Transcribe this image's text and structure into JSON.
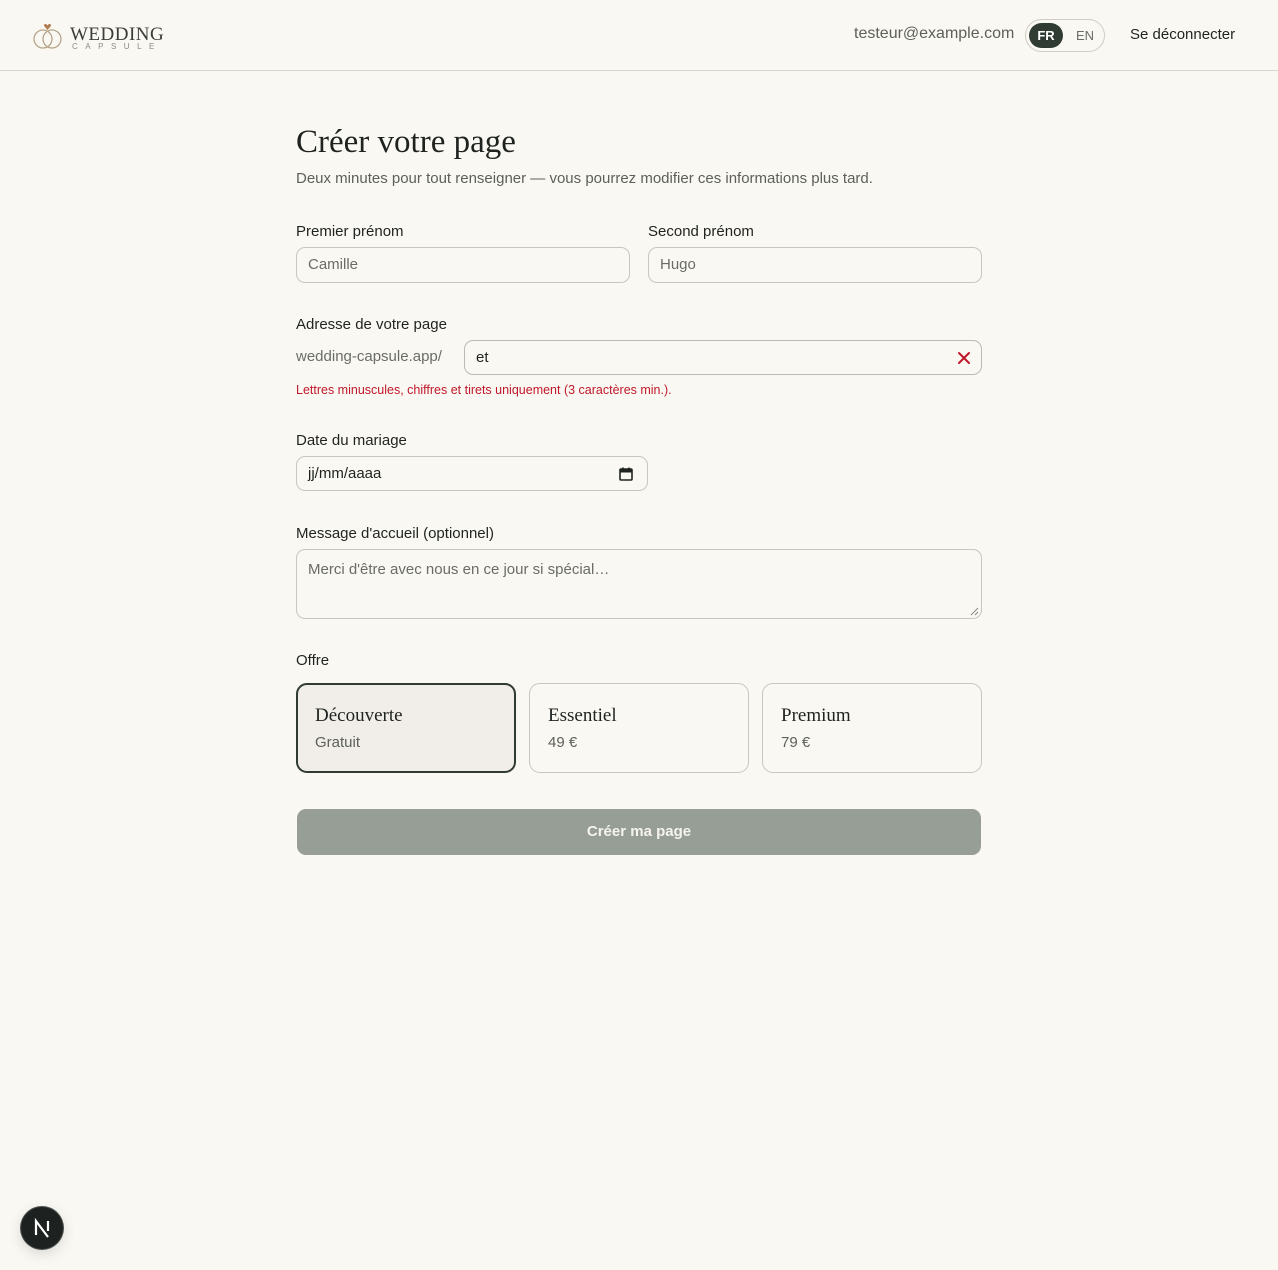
{
  "header": {
    "logo_word": "WEDDING",
    "logo_sub": "CAPSULE",
    "user_email": "testeur@example.com",
    "lang_fr": "FR",
    "lang_en": "EN",
    "logout_label": "Se déconnecter"
  },
  "form": {
    "title": "Créer votre page",
    "subtitle": "Deux minutes pour tout renseigner — vous pourrez modifier ces informations plus tard.",
    "first_name_label": "Premier prénom",
    "first_name_placeholder": "Camille",
    "second_name_label": "Second prénom",
    "second_name_placeholder": "Hugo",
    "slug_label": "Adresse de votre page",
    "slug_prefix": "wedding-capsule.app/",
    "slug_value": "et",
    "slug_error": "Lettres minuscules, chiffres et tirets uniquement (3 caractères min.).",
    "date_label": "Date du mariage",
    "date_placeholder": "jj/mm/aaaa",
    "message_label": "Message d'accueil (optionnel)",
    "message_placeholder": "Merci d'être avec nous en ce jour si spécial…",
    "offer_label": "Offre",
    "offers": [
      {
        "name": "Découverte",
        "price": "Gratuit",
        "selected": true
      },
      {
        "name": "Essentiel",
        "price": "49 €",
        "selected": false
      },
      {
        "name": "Premium",
        "price": "79 €",
        "selected": false
      }
    ],
    "submit_label": "Créer ma page"
  },
  "dev_badge": {
    "letter": "N"
  },
  "colors": {
    "background": "#faf8f3",
    "accent_dark": "#2f3b33",
    "error": "#c0182b",
    "submit_disabled": "#979e96",
    "logo_heart": "#b07a4f"
  }
}
